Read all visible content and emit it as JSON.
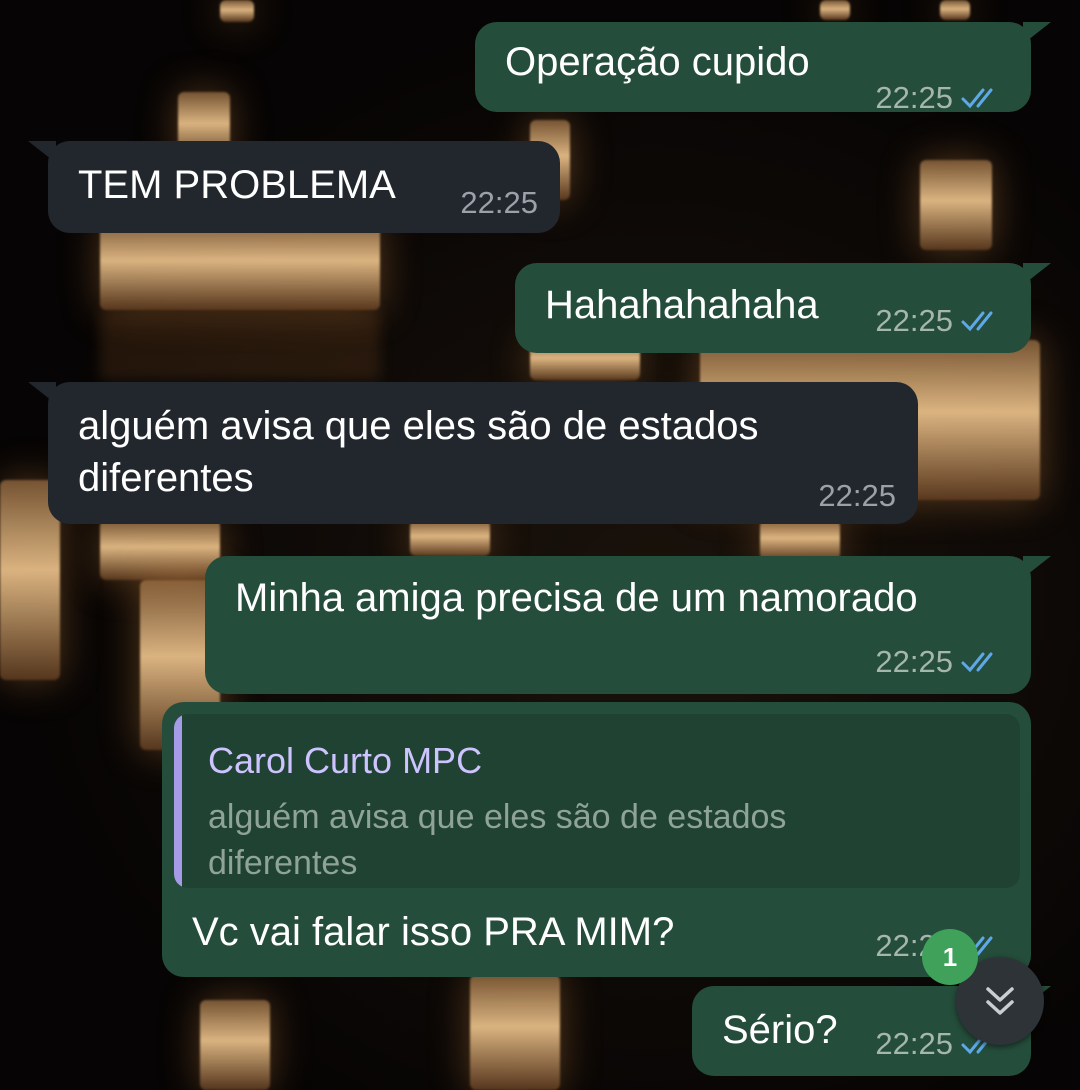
{
  "theme": {
    "outgoing_bubble": "#254d3b",
    "incoming_bubble": "#22272d",
    "tick_color": "#5fa8e8",
    "reply_bar": "#a69be6",
    "badge_color": "#3fa15a"
  },
  "messages": [
    {
      "direction": "outgoing",
      "text": "Operação cupido",
      "time": "22:25",
      "status": "read"
    },
    {
      "direction": "incoming",
      "text": "TEM PROBLEMA",
      "time": "22:25"
    },
    {
      "direction": "outgoing",
      "text": "Hahahahahaha",
      "time": "22:25",
      "status": "read"
    },
    {
      "direction": "incoming",
      "lines": [
        "alguém avisa que eles são de estados",
        "diferentes"
      ],
      "time": "22:25"
    },
    {
      "direction": "outgoing",
      "text": "Minha amiga precisa de um namorado",
      "time": "22:25",
      "status": "read"
    },
    {
      "direction": "outgoing",
      "reply_to": {
        "sender": "Carol Curto MPC",
        "lines": [
          "alguém avisa que eles são de estados",
          "diferentes"
        ]
      },
      "text": "Vc vai falar isso PRA MIM?",
      "time": "22:25",
      "status": "read"
    },
    {
      "direction": "outgoing",
      "text": "Sério?",
      "time": "22:25",
      "status": "read"
    }
  ],
  "scroll_down": {
    "icon": "double-chevron-down-icon",
    "unread_count": "1"
  }
}
